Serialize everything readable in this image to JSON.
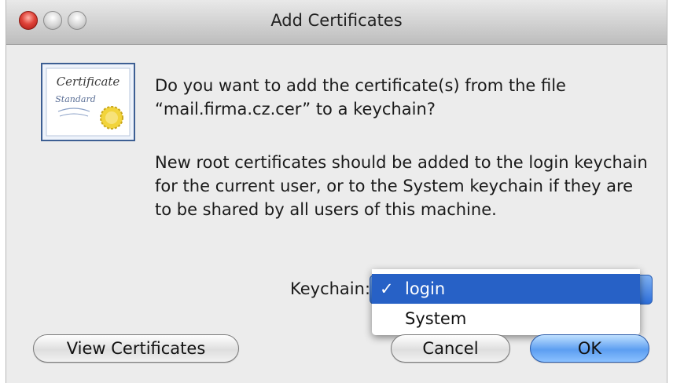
{
  "window": {
    "title": "Add Certificates"
  },
  "dialog": {
    "question": "Do you want to add the certificate(s) from the file “mail.firma.cz.cer” to a keychain?",
    "info": "New root certificates should be added to the login keychain for the current user, or to the System keychain if they are to be shared by all users of this machine.",
    "keychain_label": "Keychain:",
    "icon_text": {
      "line1": "Certificate",
      "line2": "Standard"
    }
  },
  "keychain_menu": {
    "selected_check": "✓",
    "options": [
      "login",
      "System"
    ]
  },
  "buttons": {
    "view": "View Certificates",
    "cancel": "Cancel",
    "ok": "OK"
  },
  "colors": {
    "menu_highlight": "#2761c6",
    "default_button": "#5d9ef1",
    "close_button": "#e0443a"
  }
}
